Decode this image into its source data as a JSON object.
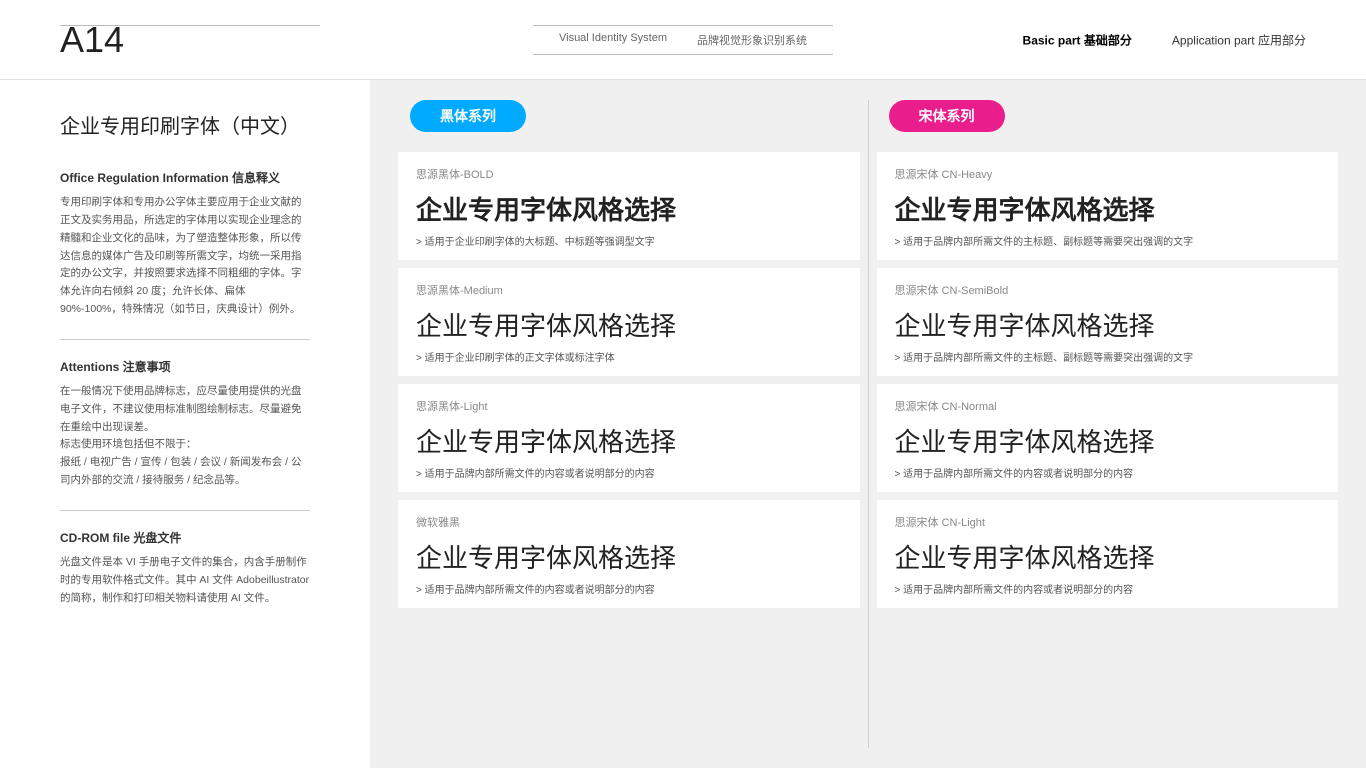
{
  "header": {
    "page_id": "A14",
    "top_line_visible": true,
    "center": {
      "left_text": "Visual Identity System",
      "right_text": "品牌视觉形象识别系统"
    },
    "right": {
      "basic_part_label": "Basic part",
      "basic_part_cn": "基础部分",
      "app_part_label": "Application part",
      "app_part_cn": "应用部分"
    }
  },
  "sidebar": {
    "title": "企业专用印刷字体（中文）",
    "sections": [
      {
        "id": "office",
        "heading": "Office Regulation Information 信息释义",
        "text": "专用印刷字体和专用办公字体主要应用于企业文献的正文及实务用品，所选定的字体用以实现企业理念的精髓和企业文化的品味，为了塑造整体形象，所以传达信息的媒体广告及印刷等所需文字，均统一采用指定的办公文字，并按照要求选择不同粗细的字体。字体允许向右倾斜 20 度；允许长体、扁体 90%-100%，特殊情况（如节日，庆典设计）例外。"
      },
      {
        "id": "attentions",
        "heading": "Attentions 注意事项",
        "text": "在一般情况下使用品牌标志，应尽量使用提供的光盘电子文件，不建议使用标准制图绘制标志。尽量避免在重绘中出现误差。\n标志使用环境包括但不限于：\n报纸 / 电视广告 / 宣传 / 包装 / 会议 / 新闻发布会 / 公司内外部的交流 / 接待服务 / 纪念品等。"
      },
      {
        "id": "cdrom",
        "heading": "CD-ROM file 光盘文件",
        "text": "光盘文件是本 VI 手册电子文件的集合，内含手册制作时的专用软件格式文件。其中 AI 文件 Adobeillustrator 的简称，制作和打印相关物料请使用 AI 文件。"
      }
    ]
  },
  "content": {
    "left_col": {
      "badge": "黑体系列",
      "badge_color": "blue",
      "cards": [
        {
          "font_name": "思源黑体-BOLD",
          "sample": "企业专用字体风格选择",
          "weight": "bold",
          "desc": "适用于企业印刷字体的大标题、中标题等强调型文字"
        },
        {
          "font_name": "思源黑体-Medium",
          "sample": "企业专用字体风格选择",
          "weight": "medium",
          "desc": "适用于企业印刷字体的正文字体或标注字体"
        },
        {
          "font_name": "思源黑体-Light",
          "sample": "企业专用字体风格选择",
          "weight": "light",
          "desc": "适用于品牌内部所需文件的内容或者说明部分的内容"
        },
        {
          "font_name": "微软雅黑",
          "sample": "企业专用字体风格选择",
          "weight": "light",
          "desc": "适用于品牌内部所需文件的内容或者说明部分的内容"
        }
      ]
    },
    "right_col": {
      "badge": "宋体系列",
      "badge_color": "pink",
      "cards": [
        {
          "font_name": "思源宋体 CN-Heavy",
          "sample": "企业专用字体风格选择",
          "weight": "bold",
          "desc": "适用于品牌内部所需文件的主标题、副标题等需要突出强调的文字"
        },
        {
          "font_name": "思源宋体 CN-SemiBold",
          "sample": "企业专用字体风格选择",
          "weight": "medium",
          "desc": "适用于品牌内部所需文件的主标题、副标题等需要突出强调的文字"
        },
        {
          "font_name": "思源宋体 CN-Normal",
          "sample": "企业专用字体风格选择",
          "weight": "light",
          "desc": "适用于品牌内部所需文件的内容或者说明部分的内容"
        },
        {
          "font_name": "思源宋体 CN-Light",
          "sample": "企业专用字体风格选择",
          "weight": "light",
          "desc": "适用于品牌内部所需文件的内容或者说明部分的内容"
        }
      ]
    }
  }
}
